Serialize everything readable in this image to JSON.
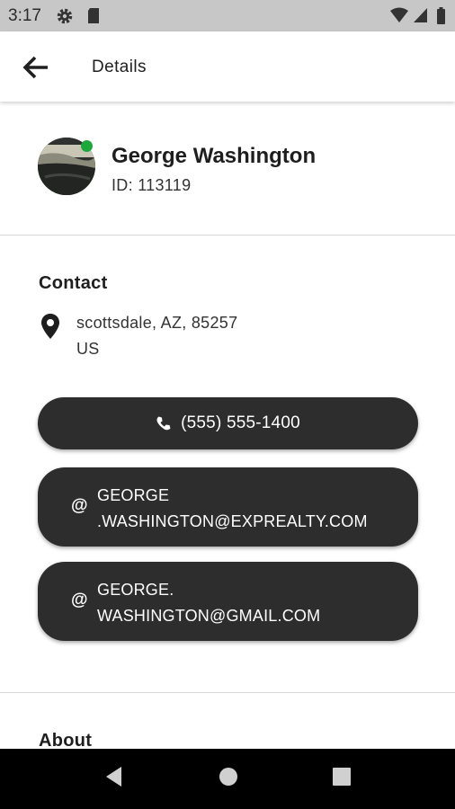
{
  "status_bar": {
    "time": "3:17",
    "icons": [
      "gear-icon",
      "sd-card-icon",
      "wifi-icon",
      "signal-icon",
      "battery-icon"
    ]
  },
  "app_bar": {
    "back_icon": "arrow-back-icon",
    "title": "Details"
  },
  "profile": {
    "name": "George Washington",
    "id_text": "ID: 113119",
    "online_color": "#1ea83c"
  },
  "contact": {
    "heading": "Contact",
    "address_line1": "scottsdale, AZ, 85257",
    "address_line2": "US",
    "phone": "(555) 555-1400",
    "email1_line1": "GEORGE",
    "email1_line2": ".WASHINGTON@EXPREALTY.COM",
    "email2_line1": "GEORGE.",
    "email2_line2": "WASHINGTON@GMAIL.COM",
    "at_symbol": "@",
    "pill_color": "#2d2d2d"
  },
  "about": {
    "heading": "About"
  },
  "nav_bar": {
    "icons": [
      "back-triangle-icon",
      "home-circle-icon",
      "recents-square-icon"
    ]
  }
}
